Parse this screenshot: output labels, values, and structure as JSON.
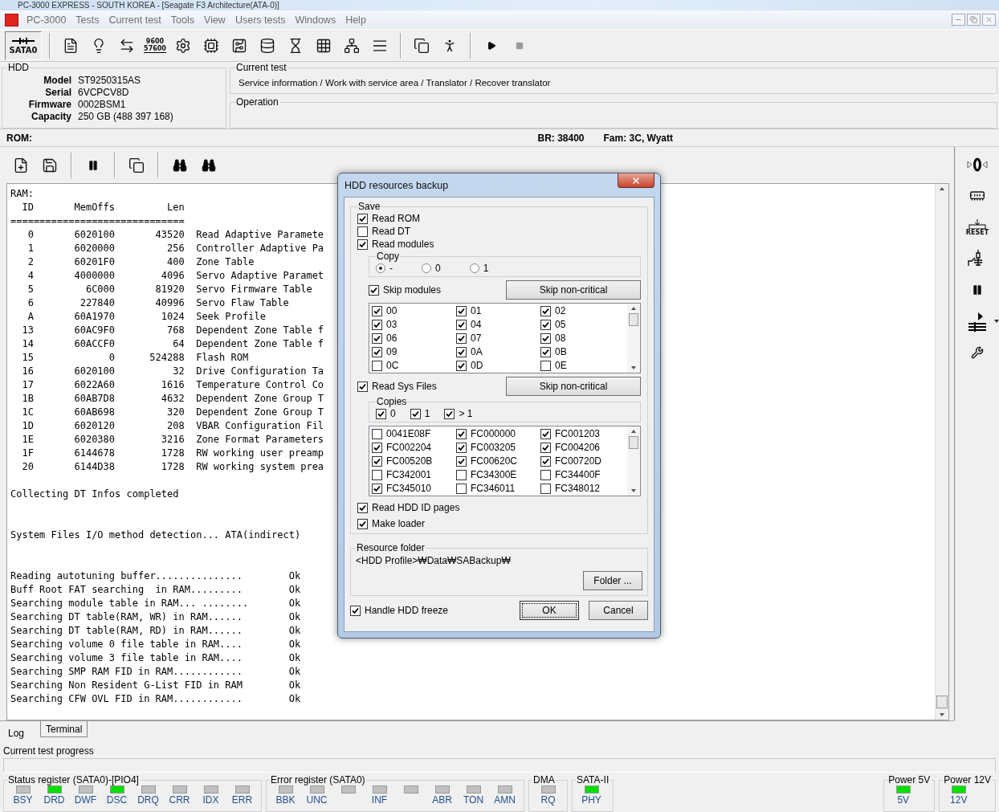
{
  "window": {
    "title": "PC-3000 EXPRESS - SOUTH KOREA - [Seagate F3 Architecture(ATA-0)]"
  },
  "menu": [
    "PC-3000",
    "Tests",
    "Current test",
    "Tools",
    "View",
    "Users tests",
    "Windows",
    "Help"
  ],
  "toolbar": {
    "port_label": "SATA0",
    "baud_icon_text": [
      "9600",
      "57600"
    ]
  },
  "hdd": {
    "title": "HDD",
    "fields": [
      {
        "label": "Model",
        "value": "ST9250315AS"
      },
      {
        "label": "Serial",
        "value": "6VCPCV8D"
      },
      {
        "label": "Firmware",
        "value": "0002BSM1"
      },
      {
        "label": "Capacity",
        "value": "250 GB (488 397 168)"
      }
    ]
  },
  "current_test": {
    "title": "Current test",
    "path": "Service information / Work with service area / Translator / Recover translator"
  },
  "operation": {
    "title": "Operation"
  },
  "rom_bar": {
    "rom": "ROM:",
    "br": "BR: 38400",
    "fam": "Fam: 3C, Wyatt"
  },
  "log": {
    "sections": [
      [
        {
          "kind": "text",
          "text": "RAM:"
        },
        {
          "kind": "header",
          "id": "ID",
          "offs": "MemOffs",
          "len": "Len"
        },
        {
          "kind": "text",
          "text": "=============================="
        },
        {
          "kind": "row",
          "id": "0",
          "offs": "6020100",
          "len": "43520",
          "desc": "Read Adaptive Paramete"
        },
        {
          "kind": "row",
          "id": "1",
          "offs": "6020000",
          "len": "256",
          "desc": "Controller Adaptive Pa"
        },
        {
          "kind": "row",
          "id": "2",
          "offs": "60201F0",
          "len": "400",
          "desc": "Zone Table"
        },
        {
          "kind": "row",
          "id": "4",
          "offs": "4000000",
          "len": "4096",
          "desc": "Servo Adaptive Paramet"
        },
        {
          "kind": "row",
          "id": "5",
          "offs": "6C000",
          "len": "81920",
          "desc": "Servo Firmware Table"
        },
        {
          "kind": "row",
          "id": "6",
          "offs": "227840",
          "len": "40996",
          "desc": "Servo Flaw Table"
        },
        {
          "kind": "row",
          "id": "A",
          "offs": "60A1970",
          "len": "1024",
          "desc": "Seek Profile"
        },
        {
          "kind": "row",
          "id": "13",
          "offs": "60AC9F0",
          "len": "768",
          "desc": "Dependent Zone Table f"
        },
        {
          "kind": "row",
          "id": "14",
          "offs": "60ACCF0",
          "len": "64",
          "desc": "Dependent Zone Table f"
        },
        {
          "kind": "row",
          "id": "15",
          "offs": "0",
          "len": "524288",
          "desc": "Flash ROM"
        },
        {
          "kind": "row",
          "id": "16",
          "offs": "6020100",
          "len": "32",
          "desc": "Drive Configuration Ta"
        },
        {
          "kind": "row",
          "id": "17",
          "offs": "6022A60",
          "len": "1616",
          "desc": "Temperature Control Co"
        },
        {
          "kind": "row",
          "id": "1B",
          "offs": "60AB7D8",
          "len": "4632",
          "desc": "Dependent Zone Group T"
        },
        {
          "kind": "row",
          "id": "1C",
          "offs": "60AB698",
          "len": "320",
          "desc": "Dependent Zone Group T"
        },
        {
          "kind": "row",
          "id": "1D",
          "offs": "6020120",
          "len": "208",
          "desc": "VBAR Configuration Fil"
        },
        {
          "kind": "row",
          "id": "1E",
          "offs": "6020380",
          "len": "3216",
          "desc": "Zone Format Parameters"
        },
        {
          "kind": "row",
          "id": "1F",
          "offs": "6144678",
          "len": "1728",
          "desc": "RW working user preamp"
        },
        {
          "kind": "row",
          "id": "20",
          "offs": "6144D38",
          "len": "1728",
          "desc": "RW working system prea"
        }
      ],
      [
        {
          "kind": "text",
          "text": "Collecting DT Infos completed"
        }
      ],
      [
        {
          "kind": "text",
          "text": "System Files I/O method detection... ATA(indirect)"
        }
      ],
      [
        {
          "kind": "status",
          "label": "Reading autotuning buffer...............",
          "result": "Ok"
        },
        {
          "kind": "status",
          "label": "Buff Root FAT searching  in RAM.........",
          "result": "Ok"
        },
        {
          "kind": "status",
          "label": "Searching module table in RAM... ........",
          "result": "Ok"
        },
        {
          "kind": "status",
          "label": "Searching DT table(RAM, WR) in RAM......",
          "result": "Ok"
        },
        {
          "kind": "status",
          "label": "Searching DT table(RAM, RD) in RAM......",
          "result": "Ok"
        },
        {
          "kind": "status",
          "label": "Searching volume 0 file table in RAM....",
          "result": "Ok"
        },
        {
          "kind": "status",
          "label": "Searching volume 3 file table in RAM....",
          "result": "Ok"
        },
        {
          "kind": "status",
          "label": "Searching SMP RAM FID in RAM............",
          "result": "Ok"
        },
        {
          "kind": "status",
          "label": "Searching Non Resident G-List FID in RAM",
          "result": "Ok"
        },
        {
          "kind": "status",
          "label": "Searching CFW OVL FID in RAM............",
          "result": "Ok"
        }
      ]
    ]
  },
  "side_toolbar": {
    "reset_text": "RESET"
  },
  "tabs": [
    {
      "label": "Log",
      "selected": true
    },
    {
      "label": "Terminal",
      "selected": false
    }
  ],
  "progress": {
    "label": "Current test progress"
  },
  "registers": [
    {
      "title": "Status register (SATA0)-[PIO4]",
      "leds": [
        {
          "label": "BSY",
          "on": false
        },
        {
          "label": "DRD",
          "on": true
        },
        {
          "label": "DWF",
          "on": false
        },
        {
          "label": "DSC",
          "on": true
        },
        {
          "label": "DRQ",
          "on": false
        },
        {
          "label": "CRR",
          "on": false
        },
        {
          "label": "IDX",
          "on": false
        },
        {
          "label": "ERR",
          "on": false
        }
      ]
    },
    {
      "title": "Error register (SATA0)",
      "leds": [
        {
          "label": "BBK",
          "on": false
        },
        {
          "label": "UNC",
          "on": false
        },
        {
          "on": false
        },
        {
          "label": "INF",
          "on": false
        },
        {
          "on": false
        },
        {
          "label": "ABR",
          "on": false
        },
        {
          "label": "TON",
          "on": false
        },
        {
          "label": "AMN",
          "on": false
        }
      ]
    },
    {
      "title": "DMA",
      "leds": [
        {
          "label": "RQ",
          "on": false
        }
      ]
    },
    {
      "title": "SATA-II",
      "leds": [
        {
          "label": "PHY",
          "on": true
        }
      ]
    }
  ],
  "power": [
    {
      "title": "Power 5V",
      "leds": [
        {
          "label": "5V",
          "on": true
        }
      ]
    },
    {
      "title": "Power 12V",
      "leds": [
        {
          "label": "12V",
          "on": true
        }
      ]
    }
  ],
  "dialog": {
    "title": "HDD resources backup",
    "save_title": "Save",
    "options": [
      {
        "label": "Read ROM",
        "checked": true
      },
      {
        "label": "Read DT",
        "checked": false
      },
      {
        "label": "Read modules",
        "checked": true
      }
    ],
    "copy": {
      "title": "Copy",
      "options": [
        {
          "label": "-",
          "selected": true
        },
        {
          "label": "0",
          "selected": false
        },
        {
          "label": "1",
          "selected": false
        }
      ]
    },
    "skip_modules": {
      "label": "Skip modules",
      "checked": true,
      "button": "Skip non-critical",
      "items": [
        {
          "label": "00",
          "checked": true
        },
        {
          "label": "01",
          "checked": true
        },
        {
          "label": "02",
          "checked": true
        },
        {
          "label": "03",
          "checked": true
        },
        {
          "label": "04",
          "checked": true
        },
        {
          "label": "05",
          "checked": true
        },
        {
          "label": "06",
          "checked": true
        },
        {
          "label": "07",
          "checked": true
        },
        {
          "label": "08",
          "checked": true
        },
        {
          "label": "09",
          "checked": true
        },
        {
          "label": "0A",
          "checked": true
        },
        {
          "label": "0B",
          "checked": true
        },
        {
          "label": "0C",
          "checked": false
        },
        {
          "label": "0D",
          "checked": true
        },
        {
          "label": "0E",
          "checked": false
        }
      ]
    },
    "sys_files": {
      "label": "Read Sys Files",
      "checked": true,
      "button": "Skip non-critical",
      "copies_title": "Copies",
      "copies": [
        {
          "label": "0",
          "checked": true
        },
        {
          "label": "1",
          "checked": true
        },
        {
          "label": "> 1",
          "checked": true
        }
      ],
      "items": [
        {
          "label": "0041E08F",
          "checked": false
        },
        {
          "label": "FC000000",
          "checked": true
        },
        {
          "label": "FC001203",
          "checked": true
        },
        {
          "label": "FC002204",
          "checked": true
        },
        {
          "label": "FC003205",
          "checked": true
        },
        {
          "label": "FC004206",
          "checked": true
        },
        {
          "label": "FC00520B",
          "checked": true
        },
        {
          "label": "FC00620C",
          "checked": true
        },
        {
          "label": "FC00720D",
          "checked": true
        },
        {
          "label": "FC342001",
          "checked": false
        },
        {
          "label": "FC34300E",
          "checked": false
        },
        {
          "label": "FC34400F",
          "checked": false
        },
        {
          "label": "FC345010",
          "checked": true
        },
        {
          "label": "FC346011",
          "checked": false
        },
        {
          "label": "FC348012",
          "checked": false
        }
      ]
    },
    "extra": [
      {
        "label": "Read HDD ID pages",
        "checked": true
      },
      {
        "label": "Make loader",
        "checked": true
      }
    ],
    "folder": {
      "title": "Resource folder",
      "path": "<HDD Profile>₩Data₩SABackup₩",
      "button": "Folder ..."
    },
    "freeze": {
      "label": "Handle HDD freeze",
      "checked": true
    },
    "buttons": [
      "OK",
      "Cancel"
    ]
  }
}
